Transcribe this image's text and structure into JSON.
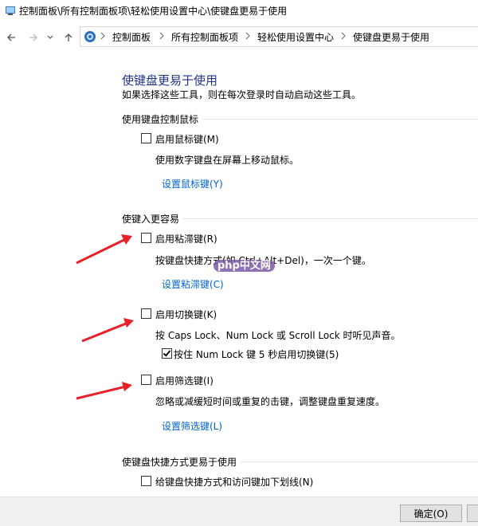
{
  "window": {
    "title": "控制面板\\所有控制面板项\\轻松使用设置中心\\使键盘更易于使用"
  },
  "nav": {
    "back_icon": "arrow-left-icon",
    "forward_icon": "arrow-right-icon",
    "recent_icon": "chevron-down-icon",
    "up_icon": "arrow-up-icon"
  },
  "breadcrumb": [
    "控制面板",
    "所有控制面板项",
    "轻松使用设置中心",
    "使键盘更易于使用"
  ],
  "page": {
    "title": "使键盘更易于使用",
    "subtitle": "如果选择这些工具，则在每次登录时自动启动这些工具。"
  },
  "mouse_group": {
    "heading": "使用键盘控制鼠标",
    "mouse_keys": {
      "label": "启用鼠标键(M)",
      "checked": false,
      "desc": "使用数字键盘在屏幕上移动鼠标。",
      "link": "设置鼠标键(Y)"
    }
  },
  "typing_group": {
    "heading": "使键入更容易",
    "sticky_keys": {
      "label": "启用粘滞键(R)",
      "checked": false,
      "desc": "按键盘快捷方式(如 Ctrl+Alt+Del)，一次一个键。",
      "link": "设置粘滞键(C)"
    },
    "toggle_keys": {
      "label": "启用切换键(K)",
      "checked": false,
      "desc": "按 Caps Lock、Num Lock 或 Scroll Lock 时听见声音。",
      "sub_option": {
        "label": "按住 Num Lock 键 5 秒启用切换键(5)",
        "checked": true
      }
    },
    "filter_keys": {
      "label": "启用筛选键(I)",
      "checked": false,
      "desc": "忽略或减缓短时间或重复的击键，调整键盘重复速度。",
      "link": "设置筛选键(L)"
    }
  },
  "shortcut_group": {
    "heading": "使键盘快捷方式更易于使用",
    "underline": {
      "label": "给键盘快捷方式和访问键加下划线(N)",
      "checked": false
    }
  },
  "watermark": "php中文网",
  "footer": {
    "ok_label": "确定(O)"
  },
  "colors": {
    "title_blue": "#1e3287",
    "link_blue": "#0066cc",
    "annotation_red": "#e8202a"
  }
}
